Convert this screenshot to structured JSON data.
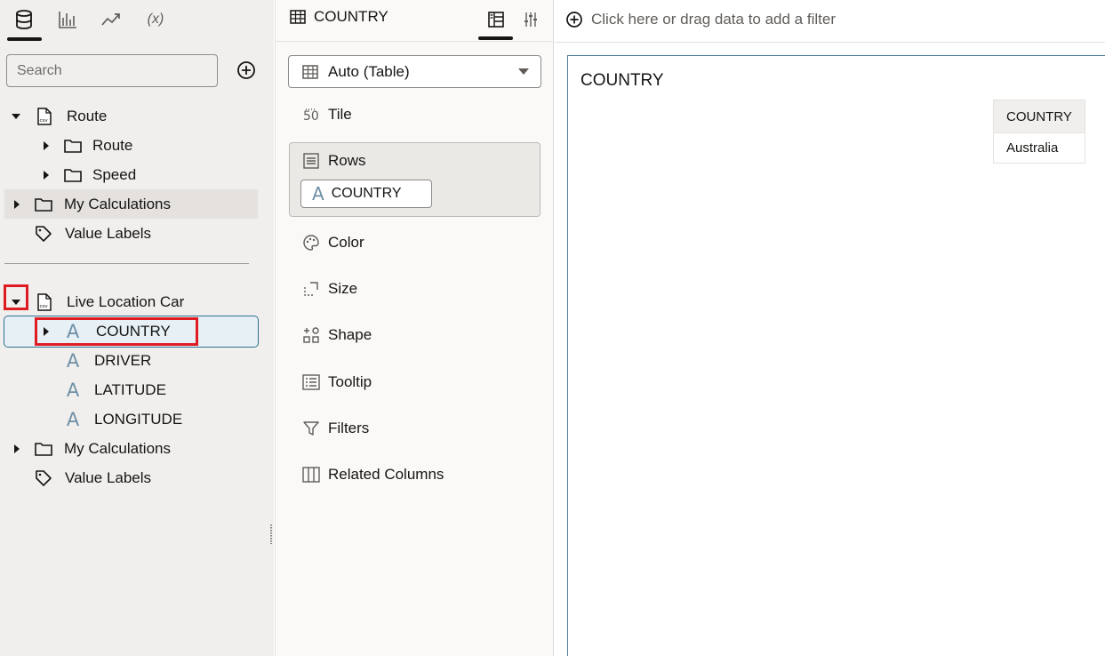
{
  "data_panel": {
    "tabs": [
      {
        "icon": "database-icon"
      },
      {
        "icon": "visualizations-icon"
      },
      {
        "icon": "analytics-icon"
      },
      {
        "icon": "expression-icon",
        "label": "(x)"
      }
    ],
    "search": {
      "placeholder": "Search"
    },
    "tree": [
      {
        "label": "Route",
        "icon": "csv-dataset-icon"
      },
      {
        "label": "Route",
        "icon": "folder-icon"
      },
      {
        "label": "Speed",
        "icon": "folder-icon"
      },
      {
        "label": "My Calculations",
        "icon": "folder-icon"
      },
      {
        "label": "Value Labels",
        "icon": "tag-icon"
      },
      {
        "label": "Live Location Car",
        "icon": "csv-dataset-icon"
      },
      {
        "label": "COUNTRY",
        "icon": "attribute-icon"
      },
      {
        "label": "DRIVER",
        "icon": "attribute-icon"
      },
      {
        "label": "LATITUDE",
        "icon": "attribute-icon"
      },
      {
        "label": "LONGITUDE",
        "icon": "attribute-icon"
      },
      {
        "label": "My Calculations",
        "icon": "folder-icon"
      },
      {
        "label": "Value Labels",
        "icon": "tag-icon"
      }
    ],
    "attribute_glyph": "A"
  },
  "grammar_panel": {
    "title": "COUNTRY",
    "viz_type": "Auto (Table)",
    "tile_label": "Tile",
    "rows_label": "Rows",
    "rows_pill": "COUNTRY",
    "assignments": [
      "Color",
      "Size",
      "Shape",
      "Tooltip",
      "Filters",
      "Related Columns"
    ]
  },
  "canvas": {
    "filter_hint": "Click here or drag data to add a filter",
    "viz_title": "COUNTRY",
    "table": {
      "columns": [
        "COUNTRY"
      ],
      "rows": [
        [
          "Australia"
        ]
      ]
    }
  },
  "colors": {
    "panel_bg": "#f1efed",
    "selection_border": "#2f6f91",
    "selection_fill": "#e6f0f5",
    "annotation_red": "#e01b22",
    "attribute_icon": "#6e8fa6"
  }
}
